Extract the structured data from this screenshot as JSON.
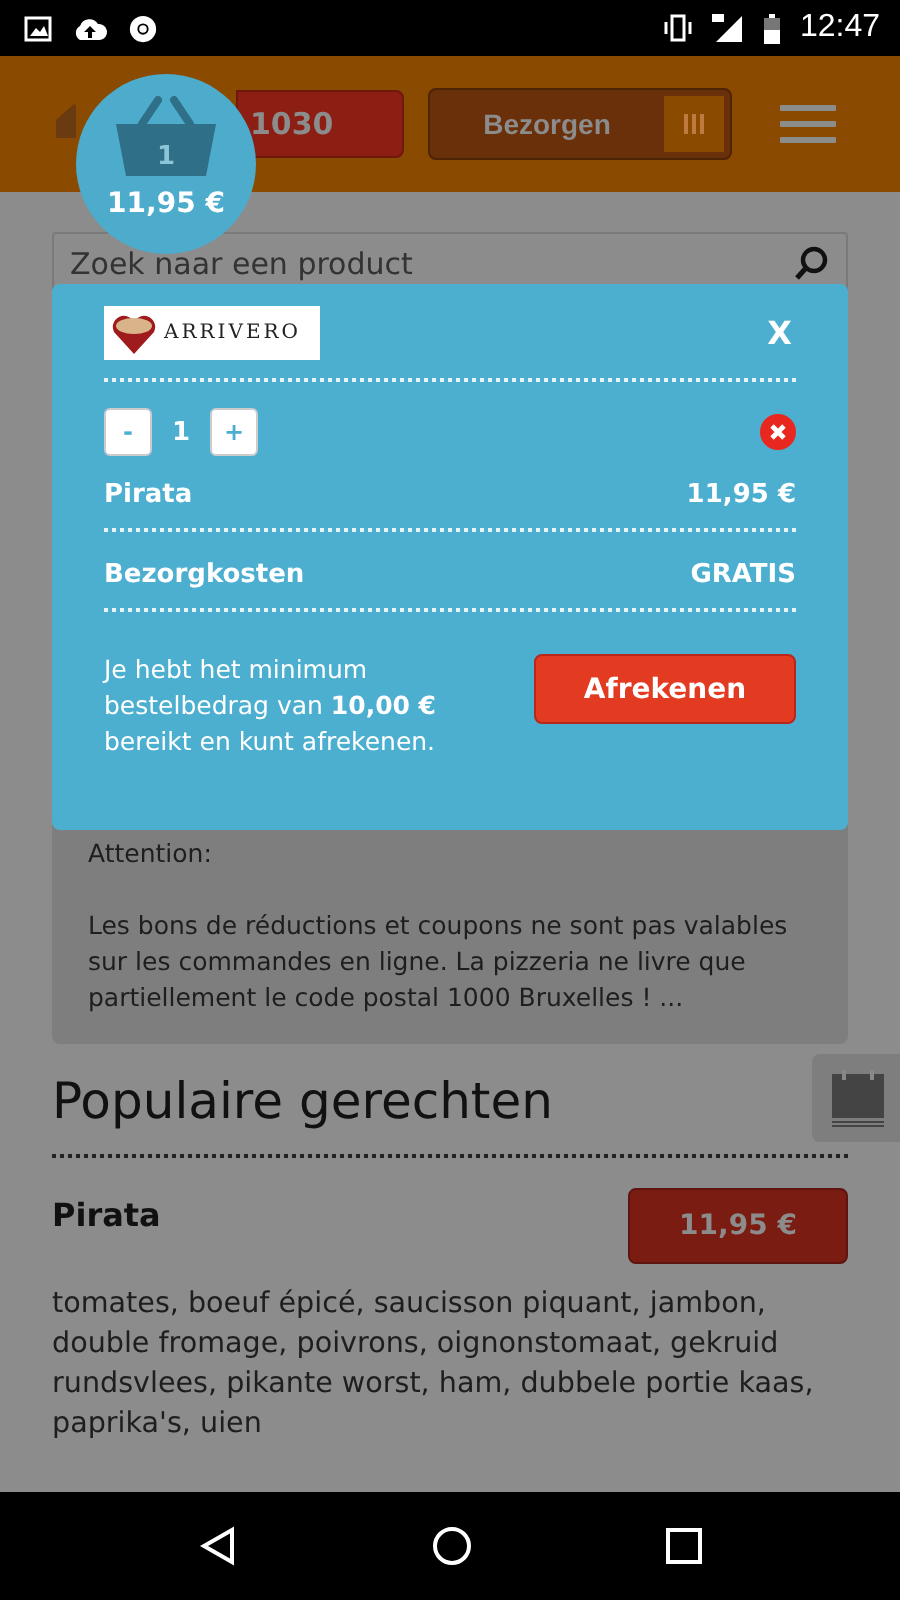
{
  "status_bar": {
    "time": "12:47"
  },
  "header": {
    "basket": {
      "count": "1",
      "total": "11,95 €"
    },
    "postcode": "1030",
    "delivery": {
      "label": "Bezorgen"
    }
  },
  "search": {
    "placeholder": "Zoek naar een product"
  },
  "cart_modal": {
    "logo_text": "ARRIVERO",
    "close": "X",
    "items": [
      {
        "minus": "-",
        "quantity": "1",
        "plus": "+",
        "name": "Pirata",
        "price": "11,95 €"
      }
    ],
    "delivery_cost": {
      "label": "Bezorgkosten",
      "value": "GRATIS"
    },
    "message": "Je hebt het minimum bestelbedrag van **10,00 €** bereikt en kunt afrekenen.",
    "checkout": "Afrekenen"
  },
  "notice": {
    "title": "Attention:",
    "text": "Les bons de réductions et coupons ne sont pas valables sur les commandes en ligne. La pizzeria ne livre que partiellement le code postal 1000 Bruxelles ! ..."
  },
  "popular": {
    "heading": "Populaire gerechten",
    "dishes": [
      {
        "name": "Pirata",
        "price": "11,95 €",
        "description": "tomates, boeuf épicé, saucisson piquant, jambon, double fromage, poivrons, oignonstomaat, gekruid rundsvlees, pikante worst, ham, dubbele portie kaas, paprika's, uien"
      }
    ]
  }
}
